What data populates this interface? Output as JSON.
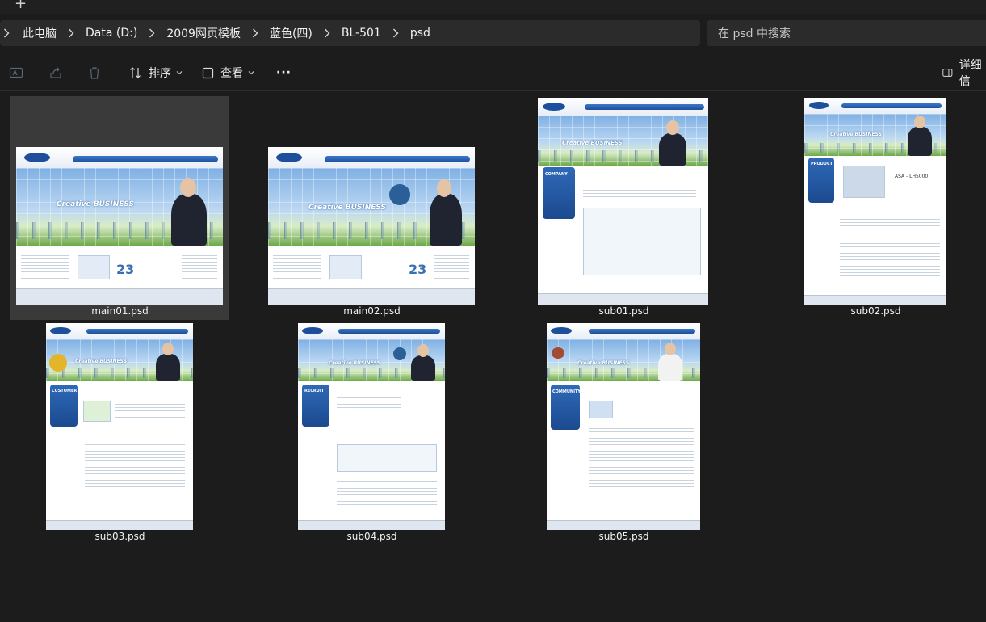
{
  "titlebar": {
    "new_tab_icon": "plus-icon"
  },
  "breadcrumb": {
    "items": [
      "此电脑",
      "Data (D:)",
      "2009网页模板",
      "蓝色(四)",
      "BL-501",
      "psd"
    ]
  },
  "search": {
    "placeholder": "在 psd 中搜索"
  },
  "toolbar": {
    "sort_label": "排序",
    "view_label": "查看",
    "more_label": "···",
    "details_label": "详细信"
  },
  "files": [
    {
      "name": "main01.psd",
      "hero_text": "Creative BUSINESS",
      "number": "23",
      "selected": true
    },
    {
      "name": "main02.psd",
      "hero_text": "Creative BUSINESS",
      "number": "23",
      "selected": false
    },
    {
      "name": "sub01.psd",
      "hero_text": "Creative BUSINESS",
      "side_title": "COMPANY",
      "selected": false
    },
    {
      "name": "sub02.psd",
      "hero_text": "Creative BUSINESS",
      "side_title": "PRODUCT",
      "product": "ASA - LH5000",
      "selected": false
    },
    {
      "name": "sub03.psd",
      "hero_text": "Creative BUSINESS",
      "side_title": "CUSTOMER",
      "selected": false
    },
    {
      "name": "sub04.psd",
      "hero_text": "Creative BUSINESS",
      "side_title": "RECRUIT",
      "selected": false
    },
    {
      "name": "sub05.psd",
      "hero_text": "Creative BUSINESS",
      "side_title": "COMMUNITY",
      "selected": false
    }
  ],
  "colors": {
    "background": "#1c1c1c",
    "bar": "#2b2b2b",
    "selection": "#3a3a3a",
    "thumb_blue": "#1e4f9a"
  }
}
